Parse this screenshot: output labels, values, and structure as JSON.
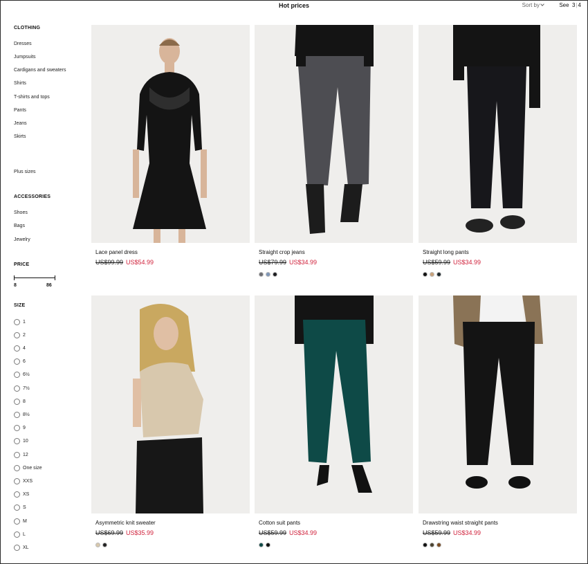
{
  "header": {
    "title": "Hot prices",
    "sort_label": "Sort by",
    "see_label": "See",
    "view_options": [
      "3",
      "4"
    ]
  },
  "sidebar": {
    "clothing_title": "CLOTHING",
    "clothing_items": [
      "Dresses",
      "Jumpsuits",
      "Cardigans and sweaters",
      "Shirts",
      "T-shirts and tops",
      "Pants",
      "Jeans",
      "Skirts"
    ],
    "plus_sizes": "Plus sizes",
    "accessories_title": "ACCESSORIES",
    "accessories_items": [
      "Shoes",
      "Bags",
      "Jewelry"
    ],
    "price_title": "PRICE",
    "price_min": "8",
    "price_max": "86",
    "size_title": "SIZE",
    "sizes": [
      "1",
      "2",
      "4",
      "6",
      "6½",
      "7½",
      "8",
      "8½",
      "9",
      "10",
      "12",
      "One size",
      "XXS",
      "XS",
      "S",
      "M",
      "L",
      "XL"
    ]
  },
  "products": [
    {
      "name": "Lace panel dress",
      "old_price": "US$99.99",
      "new_price": "US$54.99",
      "swatches": []
    },
    {
      "name": "Straight crop jeans",
      "old_price": "US$79.99",
      "new_price": "US$34.99",
      "swatches": [
        "#6e6e72",
        "#7f97b8",
        "#1c1c1f"
      ]
    },
    {
      "name": "Straight long pants",
      "old_price": "US$59.99",
      "new_price": "US$34.99",
      "swatches": [
        "#111111",
        "#c9a27a",
        "#1f2a2e"
      ]
    },
    {
      "name": "Asymmetric knit sweater",
      "old_price": "US$69.99",
      "new_price": "US$35.99",
      "swatches": [
        "#d8c8ad",
        "#222222"
      ]
    },
    {
      "name": "Cotton suit pants",
      "old_price": "US$59.99",
      "new_price": "US$34.99",
      "swatches": [
        "#0d4a47",
        "#111111"
      ]
    },
    {
      "name": "Drawstring waist straight pants",
      "old_price": "US$59.99",
      "new_price": "US$34.99",
      "swatches": [
        "#111111",
        "#4a4230",
        "#7a4b22"
      ]
    }
  ],
  "colors": {
    "sale_red": "#d0213b",
    "photo_bg": "#f0efed"
  }
}
